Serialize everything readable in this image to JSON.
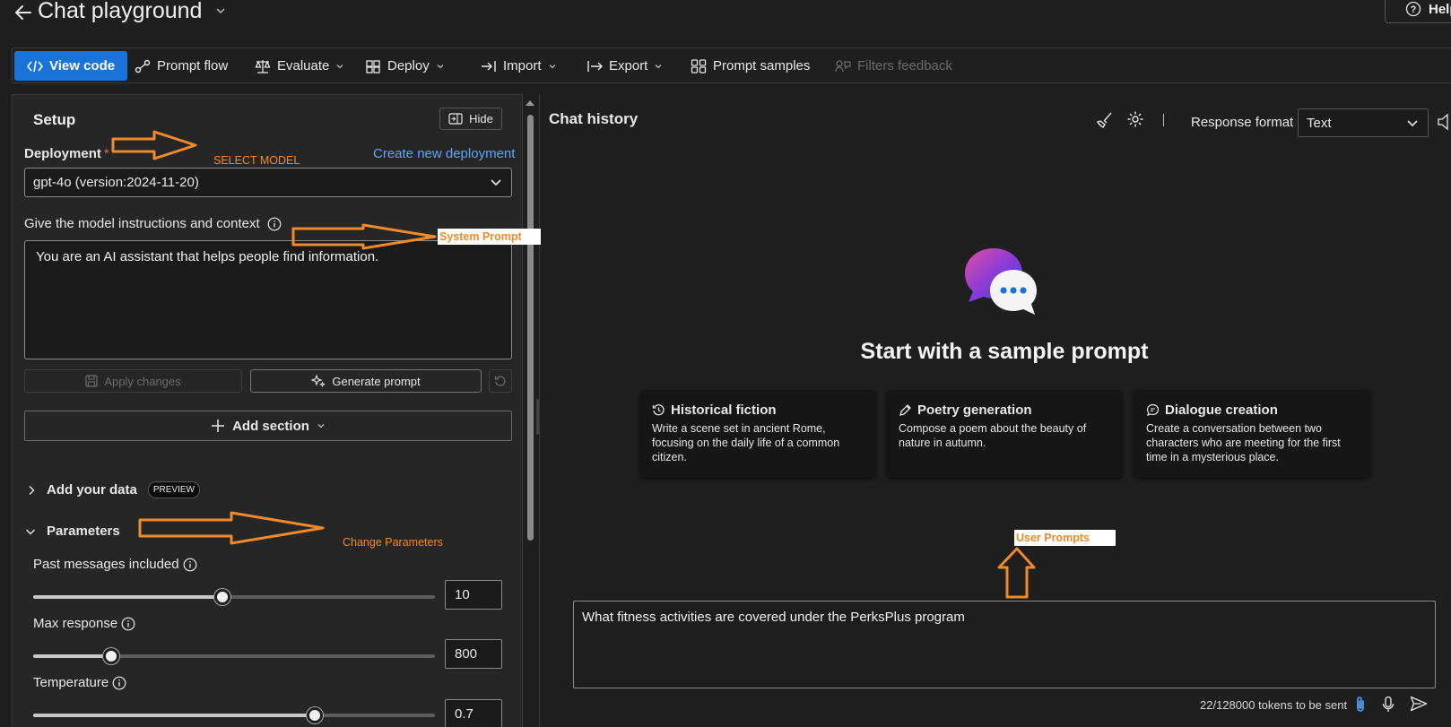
{
  "header": {
    "title": "Chat playground",
    "help_label": "Help"
  },
  "toolbar": {
    "view_code": "View code",
    "prompt_flow": "Prompt flow",
    "evaluate": "Evaluate",
    "deploy": "Deploy",
    "import": "Import",
    "export": "Export",
    "prompt_samples": "Prompt samples",
    "filters_feedback": "Filters feedback"
  },
  "setup": {
    "title": "Setup",
    "hide_label": "Hide",
    "deployment_label": "Deployment",
    "required_mark": "*",
    "create_link": "Create new deployment",
    "deployment_value": "gpt-4o (version:2024-11-20)",
    "instructions_label": "Give the model instructions and context",
    "system_message": "You are an AI assistant that helps people find information.",
    "apply_label": "Apply changes",
    "generate_label": "Generate prompt",
    "add_section_label": "Add section",
    "add_data_label": "Add your data",
    "preview_badge": "PREVIEW",
    "parameters_label": "Parameters",
    "params": {
      "past_messages": {
        "label": "Past messages included",
        "value": "10",
        "fraction": 0.47
      },
      "max_response": {
        "label": "Max response",
        "value": "800",
        "fraction": 0.195
      },
      "temperature": {
        "label": "Temperature",
        "value": "0.7",
        "fraction": 0.7
      }
    }
  },
  "chat": {
    "title": "Chat history",
    "response_format_label": "Response format",
    "response_format_value": "Text",
    "hero_title": "Start with a sample prompt",
    "cards": [
      {
        "title": "Historical fiction",
        "desc": "Write a scene set in ancient Rome, focusing on the daily life of a common citizen."
      },
      {
        "title": "Poetry generation",
        "desc": "Compose a poem about the beauty of nature in autumn."
      },
      {
        "title": "Dialogue creation",
        "desc": "Create a conversation between two characters who are meeting for the first time in a mysterious place."
      }
    ],
    "input_value": "What fitness activities are covered under the PerksPlus program",
    "token_count": "22/128000 tokens to be sent"
  },
  "annotations": {
    "select_model": "SELECT MODEL",
    "system_prompt": "System Prompt",
    "change_parameters": "Change Parameters",
    "user_prompts": "User Prompts"
  },
  "colors": {
    "accent": "#1a73d6",
    "annotation": "#f08a2a",
    "link": "#5aa7ff"
  }
}
